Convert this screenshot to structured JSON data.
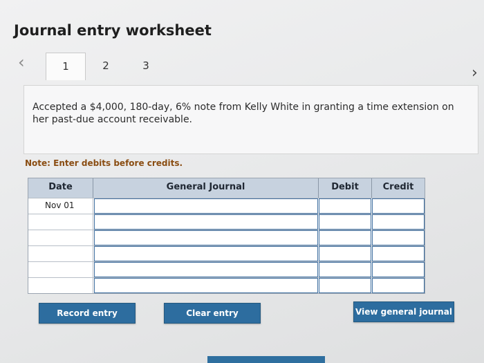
{
  "page": {
    "title": "Journal entry worksheet"
  },
  "nav": {
    "prev_icon": "chevron-left-icon",
    "next_icon": "chevron-right-icon",
    "prev_glyph": "‹",
    "next_glyph": "›",
    "tabs": [
      {
        "label": "1",
        "active": true
      },
      {
        "label": "2",
        "active": false
      },
      {
        "label": "3",
        "active": false
      }
    ]
  },
  "prompt": {
    "text": "Accepted a $4,000, 180-day, 6% note from Kelly White in granting a time extension on her past-due account receivable."
  },
  "note": {
    "text": "Note: Enter debits before credits."
  },
  "table": {
    "headers": {
      "date": "Date",
      "general_journal": "General Journal",
      "debit": "Debit",
      "credit": "Credit"
    },
    "rows": [
      {
        "date": "Nov 01"
      },
      {
        "date": ""
      },
      {
        "date": ""
      },
      {
        "date": ""
      },
      {
        "date": ""
      },
      {
        "date": ""
      }
    ]
  },
  "buttons": {
    "record": "Record entry",
    "clear": "Clear entry",
    "view": "View general journal"
  },
  "colors": {
    "button_blue": "#2d6d9f",
    "header_blue": "#c7d2df",
    "note_text": "#8a4d12"
  }
}
